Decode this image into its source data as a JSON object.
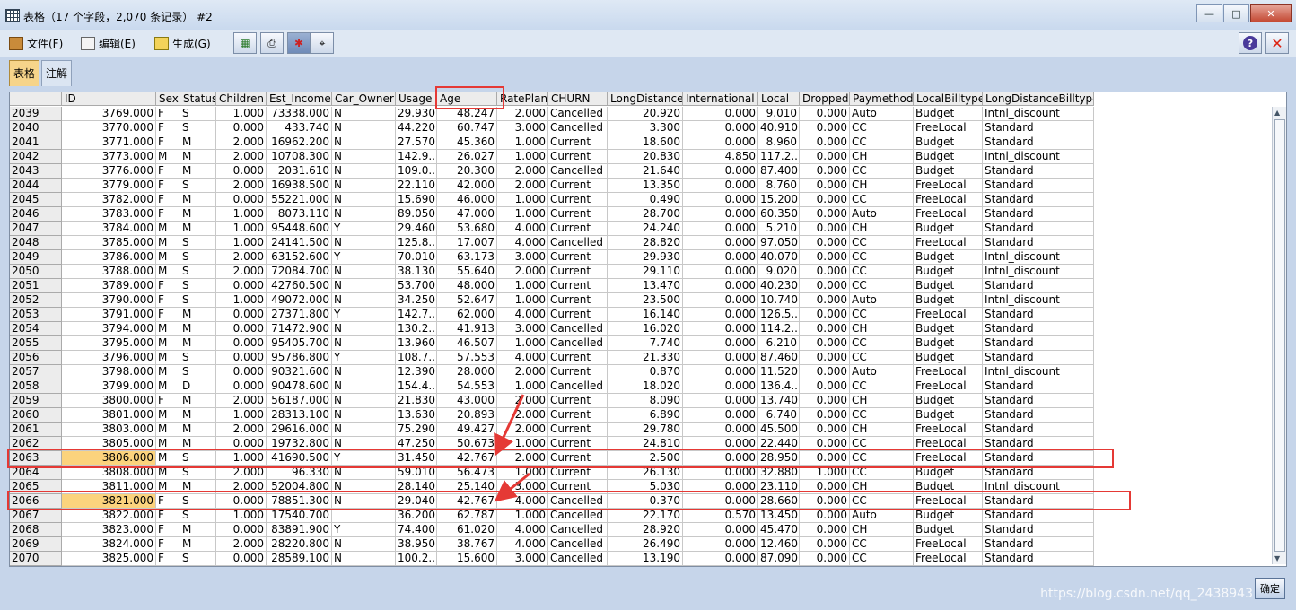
{
  "window": {
    "title": "表格（17 个字段，2,070 条记录） #2",
    "minimize": "—",
    "maximize": "□",
    "close": "✕"
  },
  "menu": [
    {
      "label": "文件(F)",
      "icon": "file-icon"
    },
    {
      "label": "编辑(E)",
      "icon": "edit-icon"
    },
    {
      "label": "生成(G)",
      "icon": "generate-icon"
    }
  ],
  "toolbar": [
    "export-icon",
    "print-icon",
    "highlight-icon",
    "binoculars-icon"
  ],
  "help": "?",
  "close_x": "✕",
  "tabs": [
    {
      "label": "表格",
      "active": true
    },
    {
      "label": "注解",
      "active": false
    }
  ],
  "columns": [
    "",
    "ID",
    "Sex",
    "Status",
    "Children",
    "Est_Income",
    "Car_Owner",
    "Usage",
    "Age",
    "RatePlan",
    "CHURN",
    "LongDistance",
    "International",
    "Local",
    "Dropped",
    "Paymethod",
    "LocalBilltype",
    "LongDistanceBilltype"
  ],
  "rows": [
    [
      "2039",
      "3769.000",
      "F",
      "S",
      "1.000",
      "73338.000",
      "N",
      "29.930",
      "48.247",
      "2.000",
      "Cancelled",
      "20.920",
      "0.000",
      "9.010",
      "0.000",
      "Auto",
      "Budget",
      "Intnl_discount"
    ],
    [
      "2040",
      "3770.000",
      "F",
      "S",
      "0.000",
      "433.740",
      "N",
      "44.220",
      "60.747",
      "3.000",
      "Cancelled",
      "3.300",
      "0.000",
      "40.910",
      "0.000",
      "CC",
      "FreeLocal",
      "Standard"
    ],
    [
      "2041",
      "3771.000",
      "F",
      "M",
      "2.000",
      "16962.200",
      "N",
      "27.570",
      "45.360",
      "1.000",
      "Current",
      "18.600",
      "0.000",
      "8.960",
      "0.000",
      "CC",
      "Budget",
      "Standard"
    ],
    [
      "2042",
      "3773.000",
      "M",
      "M",
      "2.000",
      "10708.300",
      "N",
      "142.9...",
      "26.027",
      "1.000",
      "Current",
      "20.830",
      "4.850",
      "117.2...",
      "0.000",
      "CH",
      "Budget",
      "Intnl_discount"
    ],
    [
      "2043",
      "3776.000",
      "F",
      "M",
      "0.000",
      "2031.610",
      "N",
      "109.0...",
      "20.300",
      "2.000",
      "Cancelled",
      "21.640",
      "0.000",
      "87.400",
      "0.000",
      "CC",
      "Budget",
      "Standard"
    ],
    [
      "2044",
      "3779.000",
      "F",
      "S",
      "2.000",
      "16938.500",
      "N",
      "22.110",
      "42.000",
      "2.000",
      "Current",
      "13.350",
      "0.000",
      "8.760",
      "0.000",
      "CH",
      "FreeLocal",
      "Standard"
    ],
    [
      "2045",
      "3782.000",
      "F",
      "M",
      "0.000",
      "55221.000",
      "N",
      "15.690",
      "46.000",
      "1.000",
      "Current",
      "0.490",
      "0.000",
      "15.200",
      "0.000",
      "CC",
      "FreeLocal",
      "Standard"
    ],
    [
      "2046",
      "3783.000",
      "F",
      "M",
      "1.000",
      "8073.110",
      "N",
      "89.050",
      "47.000",
      "1.000",
      "Current",
      "28.700",
      "0.000",
      "60.350",
      "0.000",
      "Auto",
      "FreeLocal",
      "Standard"
    ],
    [
      "2047",
      "3784.000",
      "M",
      "M",
      "1.000",
      "95448.600",
      "Y",
      "29.460",
      "53.680",
      "4.000",
      "Current",
      "24.240",
      "0.000",
      "5.210",
      "0.000",
      "CH",
      "Budget",
      "Standard"
    ],
    [
      "2048",
      "3785.000",
      "M",
      "S",
      "1.000",
      "24141.500",
      "N",
      "125.8...",
      "17.007",
      "4.000",
      "Cancelled",
      "28.820",
      "0.000",
      "97.050",
      "0.000",
      "CC",
      "FreeLocal",
      "Standard"
    ],
    [
      "2049",
      "3786.000",
      "M",
      "S",
      "2.000",
      "63152.600",
      "Y",
      "70.010",
      "63.173",
      "3.000",
      "Current",
      "29.930",
      "0.000",
      "40.070",
      "0.000",
      "CC",
      "Budget",
      "Intnl_discount"
    ],
    [
      "2050",
      "3788.000",
      "M",
      "S",
      "2.000",
      "72084.700",
      "N",
      "38.130",
      "55.640",
      "2.000",
      "Current",
      "29.110",
      "0.000",
      "9.020",
      "0.000",
      "CC",
      "Budget",
      "Intnl_discount"
    ],
    [
      "2051",
      "3789.000",
      "F",
      "S",
      "0.000",
      "42760.500",
      "N",
      "53.700",
      "48.000",
      "1.000",
      "Current",
      "13.470",
      "0.000",
      "40.230",
      "0.000",
      "CC",
      "Budget",
      "Standard"
    ],
    [
      "2052",
      "3790.000",
      "F",
      "S",
      "1.000",
      "49072.000",
      "N",
      "34.250",
      "52.647",
      "1.000",
      "Current",
      "23.500",
      "0.000",
      "10.740",
      "0.000",
      "Auto",
      "Budget",
      "Intnl_discount"
    ],
    [
      "2053",
      "3791.000",
      "F",
      "M",
      "0.000",
      "27371.800",
      "Y",
      "142.7...",
      "62.000",
      "4.000",
      "Current",
      "16.140",
      "0.000",
      "126.5...",
      "0.000",
      "CC",
      "FreeLocal",
      "Standard"
    ],
    [
      "2054",
      "3794.000",
      "M",
      "M",
      "0.000",
      "71472.900",
      "N",
      "130.2...",
      "41.913",
      "3.000",
      "Cancelled",
      "16.020",
      "0.000",
      "114.2...",
      "0.000",
      "CH",
      "Budget",
      "Standard"
    ],
    [
      "2055",
      "3795.000",
      "M",
      "M",
      "0.000",
      "95405.700",
      "N",
      "13.960",
      "46.507",
      "1.000",
      "Cancelled",
      "7.740",
      "0.000",
      "6.210",
      "0.000",
      "CC",
      "Budget",
      "Standard"
    ],
    [
      "2056",
      "3796.000",
      "M",
      "S",
      "0.000",
      "95786.800",
      "Y",
      "108.7...",
      "57.553",
      "4.000",
      "Current",
      "21.330",
      "0.000",
      "87.460",
      "0.000",
      "CC",
      "Budget",
      "Standard"
    ],
    [
      "2057",
      "3798.000",
      "M",
      "S",
      "0.000",
      "90321.600",
      "N",
      "12.390",
      "28.000",
      "2.000",
      "Current",
      "0.870",
      "0.000",
      "11.520",
      "0.000",
      "Auto",
      "FreeLocal",
      "Intnl_discount"
    ],
    [
      "2058",
      "3799.000",
      "M",
      "D",
      "0.000",
      "90478.600",
      "N",
      "154.4...",
      "54.553",
      "1.000",
      "Cancelled",
      "18.020",
      "0.000",
      "136.4...",
      "0.000",
      "CC",
      "FreeLocal",
      "Standard"
    ],
    [
      "2059",
      "3800.000",
      "F",
      "M",
      "2.000",
      "56187.000",
      "N",
      "21.830",
      "43.000",
      "2.000",
      "Current",
      "8.090",
      "0.000",
      "13.740",
      "0.000",
      "CH",
      "Budget",
      "Standard"
    ],
    [
      "2060",
      "3801.000",
      "M",
      "M",
      "1.000",
      "28313.100",
      "N",
      "13.630",
      "20.893",
      "2.000",
      "Current",
      "6.890",
      "0.000",
      "6.740",
      "0.000",
      "CC",
      "Budget",
      "Standard"
    ],
    [
      "2061",
      "3803.000",
      "M",
      "M",
      "2.000",
      "29616.000",
      "N",
      "75.290",
      "49.427",
      "2.000",
      "Current",
      "29.780",
      "0.000",
      "45.500",
      "0.000",
      "CH",
      "FreeLocal",
      "Standard"
    ],
    [
      "2062",
      "3805.000",
      "M",
      "M",
      "0.000",
      "19732.800",
      "N",
      "47.250",
      "50.673",
      "1.000",
      "Current",
      "24.810",
      "0.000",
      "22.440",
      "0.000",
      "CC",
      "FreeLocal",
      "Standard"
    ],
    [
      "2063",
      "3806.000",
      "M",
      "S",
      "1.000",
      "41690.500",
      "Y",
      "31.450",
      "42.767",
      "2.000",
      "Current",
      "2.500",
      "0.000",
      "28.950",
      "0.000",
      "CC",
      "FreeLocal",
      "Standard"
    ],
    [
      "2064",
      "3808.000",
      "M",
      "S",
      "2.000",
      "96.330",
      "N",
      "59.010",
      "56.473",
      "1.000",
      "Current",
      "26.130",
      "0.000",
      "32.880",
      "1.000",
      "CC",
      "Budget",
      "Standard"
    ],
    [
      "2065",
      "3811.000",
      "M",
      "M",
      "2.000",
      "52004.800",
      "N",
      "28.140",
      "25.140",
      "3.000",
      "Current",
      "5.030",
      "0.000",
      "23.110",
      "0.000",
      "CH",
      "Budget",
      "Intnl_discount"
    ],
    [
      "2066",
      "3821.000",
      "F",
      "S",
      "0.000",
      "78851.300",
      "N",
      "29.040",
      "42.767",
      "4.000",
      "Cancelled",
      "0.370",
      "0.000",
      "28.660",
      "0.000",
      "CC",
      "FreeLocal",
      "Standard"
    ],
    [
      "2067",
      "3822.000",
      "F",
      "S",
      "1.000",
      "17540.700",
      "",
      "36.200",
      "62.787",
      "1.000",
      "Cancelled",
      "22.170",
      "0.570",
      "13.450",
      "0.000",
      "Auto",
      "Budget",
      "Standard"
    ],
    [
      "2068",
      "3823.000",
      "F",
      "M",
      "0.000",
      "83891.900",
      "Y",
      "74.400",
      "61.020",
      "4.000",
      "Cancelled",
      "28.920",
      "0.000",
      "45.470",
      "0.000",
      "CH",
      "Budget",
      "Standard"
    ],
    [
      "2069",
      "3824.000",
      "F",
      "M",
      "2.000",
      "28220.800",
      "N",
      "38.950",
      "38.767",
      "4.000",
      "Cancelled",
      "26.490",
      "0.000",
      "12.460",
      "0.000",
      "CC",
      "FreeLocal",
      "Standard"
    ],
    [
      "2070",
      "3825.000",
      "F",
      "S",
      "0.000",
      "28589.100",
      "N",
      "100.2...",
      "15.600",
      "3.000",
      "Cancelled",
      "13.190",
      "0.000",
      "87.090",
      "0.000",
      "CC",
      "FreeLocal",
      "Standard"
    ]
  ],
  "ok_label": "确定",
  "watermark": "https://blog.csdn.net/qq_2438943"
}
